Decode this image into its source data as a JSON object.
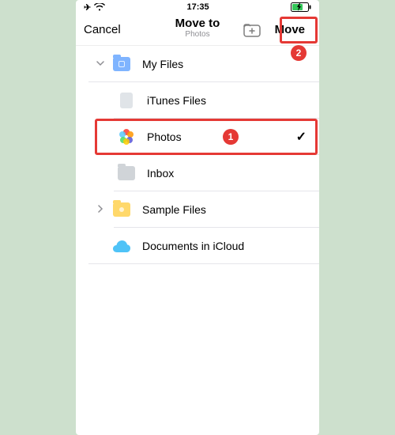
{
  "status": {
    "time": "17:35"
  },
  "nav": {
    "cancel": "Cancel",
    "title": "Move to",
    "subtitle": "Photos",
    "move": "Move"
  },
  "rows": {
    "myFiles": "My Files",
    "itunes": "iTunes Files",
    "photos": "Photos",
    "inbox": "Inbox",
    "sample": "Sample Files",
    "icloud": "Documents in iCloud"
  },
  "annotations": {
    "badge1": "1",
    "badge2": "2"
  }
}
